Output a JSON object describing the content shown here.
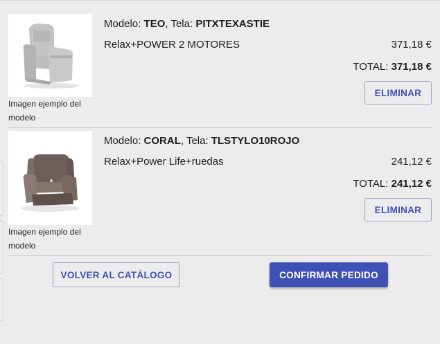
{
  "cart": {
    "items": [
      {
        "model_label": "Modelo: ",
        "model": "TEO",
        "fabric_label": ", Tela: ",
        "fabric": "PITXTEXASTIE",
        "description": "Relax+POWER 2 MOTORES",
        "price": "371,18 €",
        "total_label": "TOTAL: ",
        "total": "371,18 €",
        "image_caption": "Imagen ejemplo del modelo",
        "image_icon": "grey-recliner-chair-photo",
        "remove_label": "ELIMINAR"
      },
      {
        "model_label": "Modelo: ",
        "model": "CORAL",
        "fabric_label": ", Tela: ",
        "fabric": "TLSTYLO10ROJO",
        "description": "Relax+Power Life+ruedas",
        "price": "241,12 €",
        "total_label": "TOTAL: ",
        "total": "241,12 €",
        "image_caption": "Imagen ejemplo del modelo",
        "image_icon": "taupe-recliner-chair-photo",
        "remove_label": "ELIMINAR"
      }
    ]
  },
  "actions": {
    "back_label": "VOLVER AL CATÁLOGO",
    "confirm_label": "CONFIRMAR PEDIDO"
  },
  "colors": {
    "primary": "#3f51b5",
    "background": "#ececec",
    "outline": "#9fa4c8"
  }
}
